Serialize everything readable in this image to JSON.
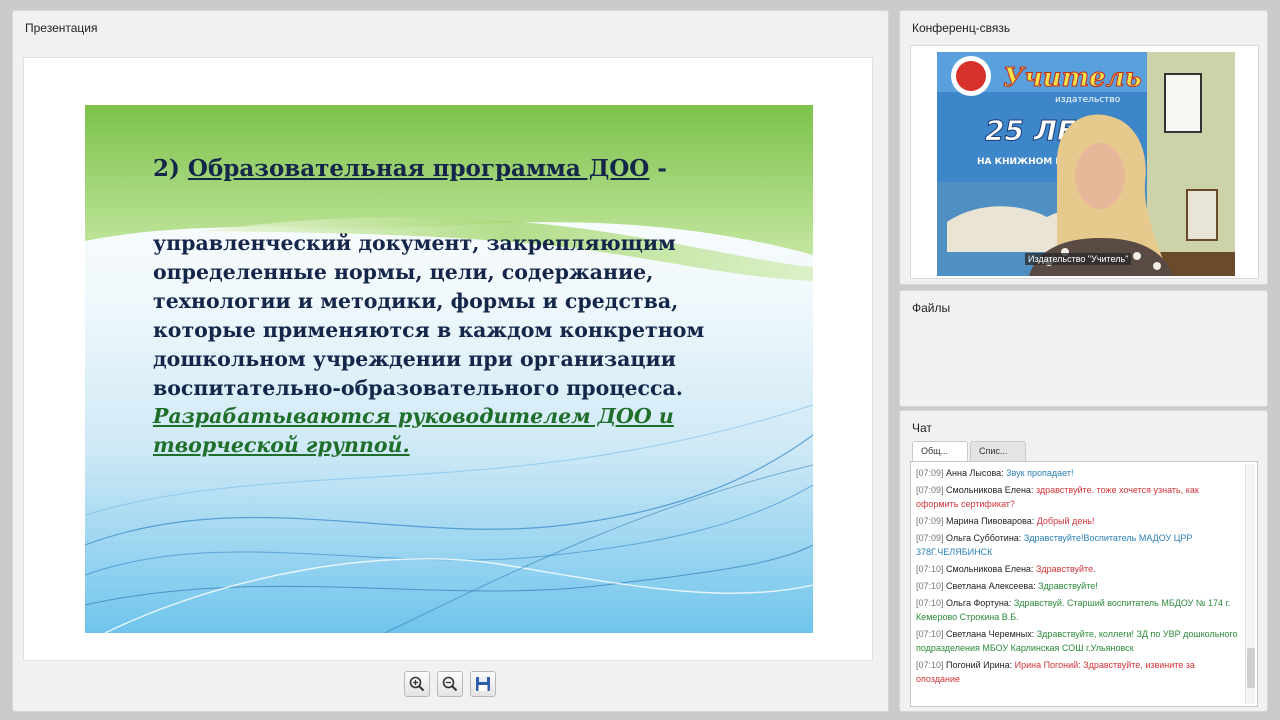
{
  "presentation": {
    "title": "Презентация",
    "slide": {
      "heading_prefix": "2) ",
      "heading_main": "Образовательная программа ДОО",
      "heading_suffix": " -",
      "body_lines": [
        "управленческий документ, закрепляющим",
        "определенные нормы, цели, содержание,",
        "технологии и методики, формы и средства,",
        "которые применяются в каждом конкретном",
        "дошкольном учреждении при организации",
        "воспитательно-образовательного процесса."
      ],
      "emphasis_lines": [
        "Разрабатываются руководителем ДОО и",
        "творческой группой."
      ]
    },
    "toolbar": [
      {
        "name": "zoom-in-button",
        "icon": "zoom-in-icon"
      },
      {
        "name": "zoom-out-button",
        "icon": "zoom-out-icon"
      },
      {
        "name": "save-button",
        "icon": "floppy-disk-icon"
      }
    ]
  },
  "conference": {
    "title": "Конференц-связь",
    "video_label": "Издательство \"Учитель\"",
    "banner_text": "Учитель",
    "banner_subtext": "издательство",
    "banner_years": "25 ЛЕТ",
    "banner_tagline": "НА КНИЖНОМ РЫНКЕ Р"
  },
  "files": {
    "title": "Файлы"
  },
  "chat": {
    "title": "Чат",
    "tabs": [
      "Общ...",
      "Спис..."
    ],
    "messages": [
      {
        "time": "[07:09]",
        "author": "Анна Лысова:",
        "text": "Звук пропадает!",
        "color": "#2a7fb8"
      },
      {
        "time": "[07:09]",
        "author": "Смольникова Елена:",
        "text": "здравствуйте. тоже хочется узнать, как оформить сертификат?",
        "color": "#d0343a"
      },
      {
        "time": "[07:09]",
        "author": "Марина Пивоварова:",
        "text": "Добрый день!",
        "color": "#d0343a"
      },
      {
        "time": "[07:09]",
        "author": "Ольга Субботина:",
        "text": "Здравствуйте!Воспитатель МАДОУ ЦРР 378Г.ЧЕЛЯБИНСК",
        "color": "#2a7fb8"
      },
      {
        "time": "[07:10]",
        "author": "Смольникова Елена:",
        "text": "Здравствуйте.",
        "color": "#d0343a"
      },
      {
        "time": "[07:10]",
        "author": "Светлана Алексеева:",
        "text": "Здравствуйте!",
        "color": "#2c8a3a"
      },
      {
        "time": "[07:10]",
        "author": "Ольга Фортуна:",
        "text": "Здравствуй. Старший воспитатель МБДОУ № 174 г. Кемерово Строкина В.Б.",
        "color": "#2c8a3a"
      },
      {
        "time": "[07:10]",
        "author": "Светлана Черемных:",
        "text": "Здравствуйте, коллеги! ЗД по УВР дошкольного подразделения МБОУ Карлинская СОШ г.Ульяновск",
        "color": "#2c8a3a"
      },
      {
        "time": "[07:10]",
        "author": "Погоний Ирина:",
        "text": "Ирина Погоний: Здравствуйте, извините за опоздание",
        "color": "#d0343a"
      }
    ]
  }
}
